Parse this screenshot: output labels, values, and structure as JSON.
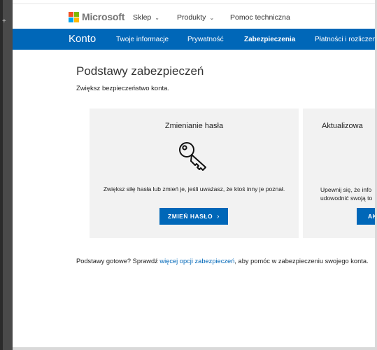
{
  "header": {
    "brand": "Microsoft",
    "nav": [
      {
        "label": "Sklep",
        "has_dropdown": true
      },
      {
        "label": "Produkty",
        "has_dropdown": true
      },
      {
        "label": "Pomoc techniczna",
        "has_dropdown": false
      }
    ],
    "chevron": "⌄"
  },
  "account_nav": {
    "title": "Konto",
    "items": [
      {
        "label": "Twoje informacje",
        "active": false
      },
      {
        "label": "Prywatność",
        "active": false
      },
      {
        "label": "Zabezpieczenia",
        "active": true
      },
      {
        "label": "Płatności i rozliczenia",
        "active": false
      }
    ]
  },
  "main": {
    "title": "Podstawy zabezpieczeń",
    "subtitle": "Zwiększ bezpieczeństwo konta.",
    "cards": [
      {
        "title": "Zmienianie hasła",
        "icon": "key-icon",
        "description": "Zwiększ siłę hasła lub zmień je, jeśli uważasz, że ktoś inny je poznał.",
        "button": "ZMIEŃ HASŁO",
        "button_chevron": "›"
      },
      {
        "title": "Aktualizowa",
        "description_line1": "Upewnij się, że info",
        "description_line2": "udowodnić swoją to",
        "button": "AK"
      }
    ],
    "footer": {
      "before": "Podstawy gotowe? Sprawdź ",
      "link": "więcej opcji zabezpieczeń",
      "after": ", aby pomóc w zabezpieczeniu swojego konta."
    }
  },
  "colors": {
    "brand_blue": "#0067b8",
    "card_bg": "#f2f2f2",
    "logo_red": "#f25022",
    "logo_green": "#7fba00",
    "logo_blue": "#00a4ef",
    "logo_yellow": "#ffb900"
  }
}
